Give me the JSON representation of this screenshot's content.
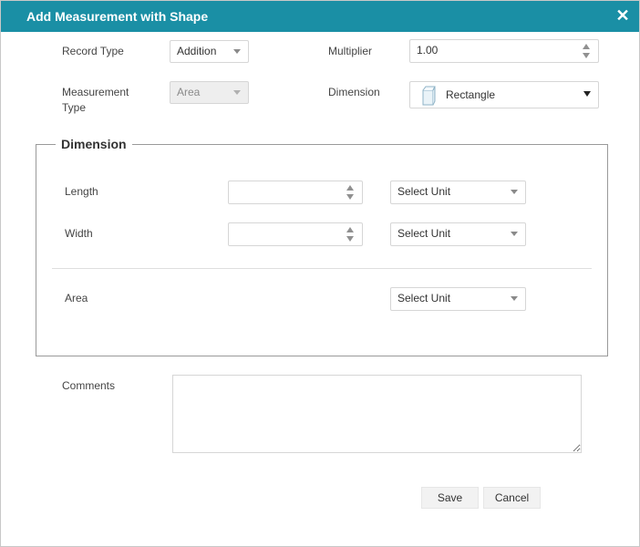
{
  "dialog": {
    "title": "Add Measurement with Shape"
  },
  "form": {
    "record_type": {
      "label": "Record Type",
      "value": "Addition"
    },
    "multiplier": {
      "label": "Multiplier",
      "value": "1.00"
    },
    "measurement_type": {
      "label_line1": "Measurement",
      "label_line2": "Type",
      "value": "Area"
    },
    "dimension": {
      "label": "Dimension",
      "value": "Rectangle",
      "icon": "rectangle-shape-icon"
    }
  },
  "dimension_section": {
    "legend": "Dimension",
    "length": {
      "label": "Length",
      "value": "",
      "unit": "Select Unit"
    },
    "width": {
      "label": "Width",
      "value": "",
      "unit": "Select Unit"
    },
    "area": {
      "label": "Area",
      "unit": "Select Unit"
    }
  },
  "comments": {
    "label": "Comments",
    "value": ""
  },
  "buttons": {
    "save": "Save",
    "cancel": "Cancel"
  },
  "colors": {
    "titlebar": "#1a8fa5",
    "title_text": "#ffffff"
  }
}
